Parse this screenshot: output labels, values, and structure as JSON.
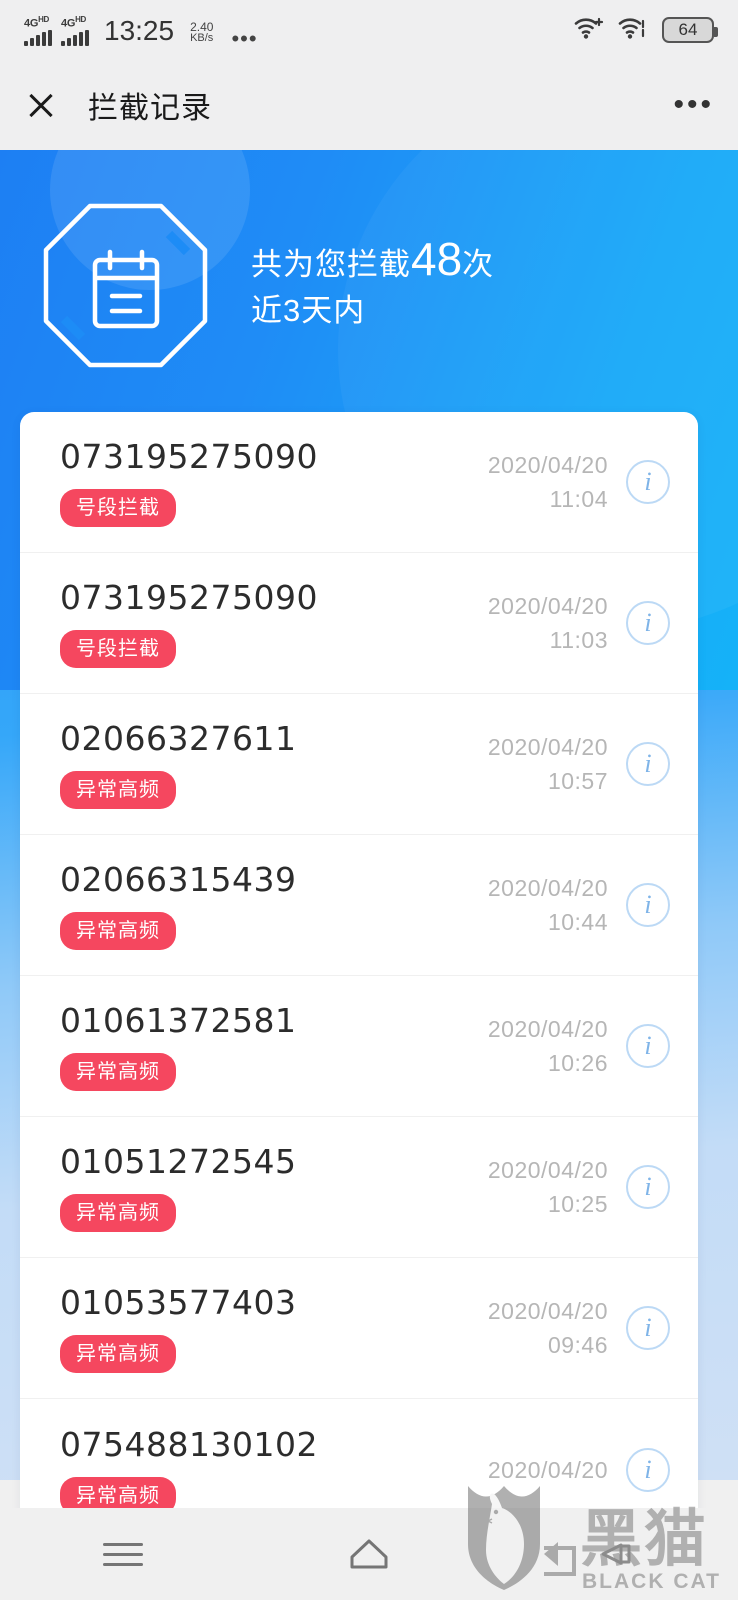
{
  "status_bar": {
    "network_label": "4G",
    "network_suffix": "HD",
    "sim_count": 2,
    "time": "13:25",
    "data_rate_value": "2.40",
    "data_rate_unit": "KB/s",
    "overflow_dots": "•••",
    "wifi_primary_icon": "wifi-plus-icon",
    "wifi_secondary_icon": "wifi-transfer-icon",
    "battery_level": "64"
  },
  "app_bar": {
    "close_icon": "close-icon",
    "title": "拦截记录",
    "more_icon": "more-horizontal-icon",
    "more_label": "•••"
  },
  "banner": {
    "shield_icon": "blocked-record-octagon-icon",
    "prefix_text": "共为您拦截",
    "count": "48",
    "suffix_text": "次",
    "subtitle": "近3天内",
    "accent_color": "#1d8cf6",
    "text_color": "#ffffff"
  },
  "list": {
    "tag_color": "#f5475f",
    "info_icon": "info-circle-icon",
    "info_label": "i",
    "items": [
      {
        "number": "073195275090",
        "tag": "号段拦截",
        "date": "2020/04/20",
        "time": "11:04"
      },
      {
        "number": "073195275090",
        "tag": "号段拦截",
        "date": "2020/04/20",
        "time": "11:03"
      },
      {
        "number": "02066327611",
        "tag": "异常高频",
        "date": "2020/04/20",
        "time": "10:57"
      },
      {
        "number": "02066315439",
        "tag": "异常高频",
        "date": "2020/04/20",
        "time": "10:44"
      },
      {
        "number": "01061372581",
        "tag": "异常高频",
        "date": "2020/04/20",
        "time": "10:26"
      },
      {
        "number": "01051272545",
        "tag": "异常高频",
        "date": "2020/04/20",
        "time": "10:25"
      },
      {
        "number": "01053577403",
        "tag": "异常高频",
        "date": "2020/04/20",
        "time": "09:46"
      },
      {
        "number": "075488130102",
        "tag": "异常高频",
        "date": "2020/04/20",
        "time": ""
      }
    ]
  },
  "nav_bar": {
    "menu_icon": "menu-icon",
    "home_icon": "home-icon",
    "back_icon": "back-arrow-icon"
  },
  "watermark": {
    "cat_icon": "black-cat-shield-icon",
    "title_cn": "黑猫",
    "title_en": "BLACK CAT"
  }
}
